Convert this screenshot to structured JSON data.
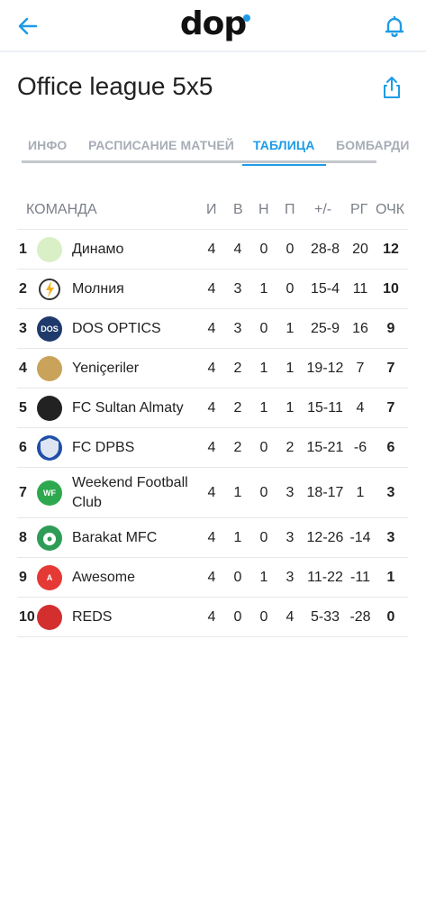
{
  "header": {
    "logo": "dop",
    "back_icon": "arrow-left-icon",
    "bell_icon": "bell-icon"
  },
  "page": {
    "title": "Office league 5x5",
    "share_icon": "share-icon"
  },
  "tabs": [
    {
      "label": "ИНФО",
      "active": false
    },
    {
      "label": "РАСПИСАНИЕ МАТЧЕЙ",
      "active": false
    },
    {
      "label": "ТАБЛИЦА",
      "active": true
    },
    {
      "label": "БОМБАРДИ",
      "active": false
    }
  ],
  "table": {
    "headers": {
      "team": "КОМАНДА",
      "played": "И",
      "won": "В",
      "drawn": "Н",
      "lost": "П",
      "goals": "+/-",
      "diff": "РГ",
      "points": "ОЧК"
    },
    "rows": [
      {
        "pos": "1",
        "name": "Динамо",
        "played": "4",
        "won": "4",
        "drawn": "0",
        "lost": "0",
        "goals": "28-8",
        "diff": "20",
        "points": "12",
        "logo_color": "#d9efc6",
        "logo_icon": "dinamo-logo-icon"
      },
      {
        "pos": "2",
        "name": "Молния",
        "played": "4",
        "won": "3",
        "drawn": "1",
        "lost": "0",
        "goals": "15-4",
        "diff": "11",
        "points": "10",
        "logo_color": "#ffffff",
        "logo_icon": "lightning-logo-icon"
      },
      {
        "pos": "3",
        "name": "DOS OPTICS",
        "played": "4",
        "won": "3",
        "drawn": "0",
        "lost": "1",
        "goals": "25-9",
        "diff": "16",
        "points": "9",
        "logo_color": "#1d3a6b",
        "logo_icon": "dos-logo-icon",
        "logo_text": "DOS"
      },
      {
        "pos": "4",
        "name": "Yeniçeriler",
        "played": "4",
        "won": "2",
        "drawn": "1",
        "lost": "1",
        "goals": "19-12",
        "diff": "7",
        "points": "7",
        "logo_color": "#c9a35a",
        "logo_icon": "yeniceriler-logo-icon"
      },
      {
        "pos": "5",
        "name": "FC Sultan Almaty",
        "played": "4",
        "won": "2",
        "drawn": "1",
        "lost": "1",
        "goals": "15-11",
        "diff": "4",
        "points": "7",
        "logo_color": "#222222",
        "logo_icon": "sultan-logo-icon"
      },
      {
        "pos": "6",
        "name": "FC DPBS",
        "played": "4",
        "won": "2",
        "drawn": "0",
        "lost": "2",
        "goals": "15-21",
        "diff": "-6",
        "points": "6",
        "logo_color": "#1f4fa8",
        "logo_icon": "dpbs-shield-logo-icon"
      },
      {
        "pos": "7",
        "name": "Weekend Football Club",
        "played": "4",
        "won": "1",
        "drawn": "0",
        "lost": "3",
        "goals": "18-17",
        "diff": "1",
        "points": "3",
        "logo_color": "#2ea84f",
        "logo_icon": "weekend-logo-icon",
        "logo_text": "WF"
      },
      {
        "pos": "8",
        "name": "Barakat MFC",
        "played": "4",
        "won": "1",
        "drawn": "0",
        "lost": "3",
        "goals": "12-26",
        "diff": "-14",
        "points": "3",
        "logo_color": "#2e9c57",
        "logo_icon": "barakat-logo-icon"
      },
      {
        "pos": "9",
        "name": "Awesome",
        "played": "4",
        "won": "0",
        "drawn": "1",
        "lost": "3",
        "goals": "11-22",
        "diff": "-11",
        "points": "1",
        "logo_color": "#e53935",
        "logo_icon": "awesome-logo-icon",
        "logo_text": "A"
      },
      {
        "pos": "10",
        "name": "REDS",
        "played": "4",
        "won": "0",
        "drawn": "0",
        "lost": "4",
        "goals": "5-33",
        "diff": "-28",
        "points": "0",
        "logo_color": "#d32f2f",
        "logo_icon": "reds-logo-icon"
      }
    ]
  },
  "colors": {
    "accent": "#1e9be6",
    "tab_inactive": "#a7adb6",
    "header_text": "#7b8089"
  }
}
